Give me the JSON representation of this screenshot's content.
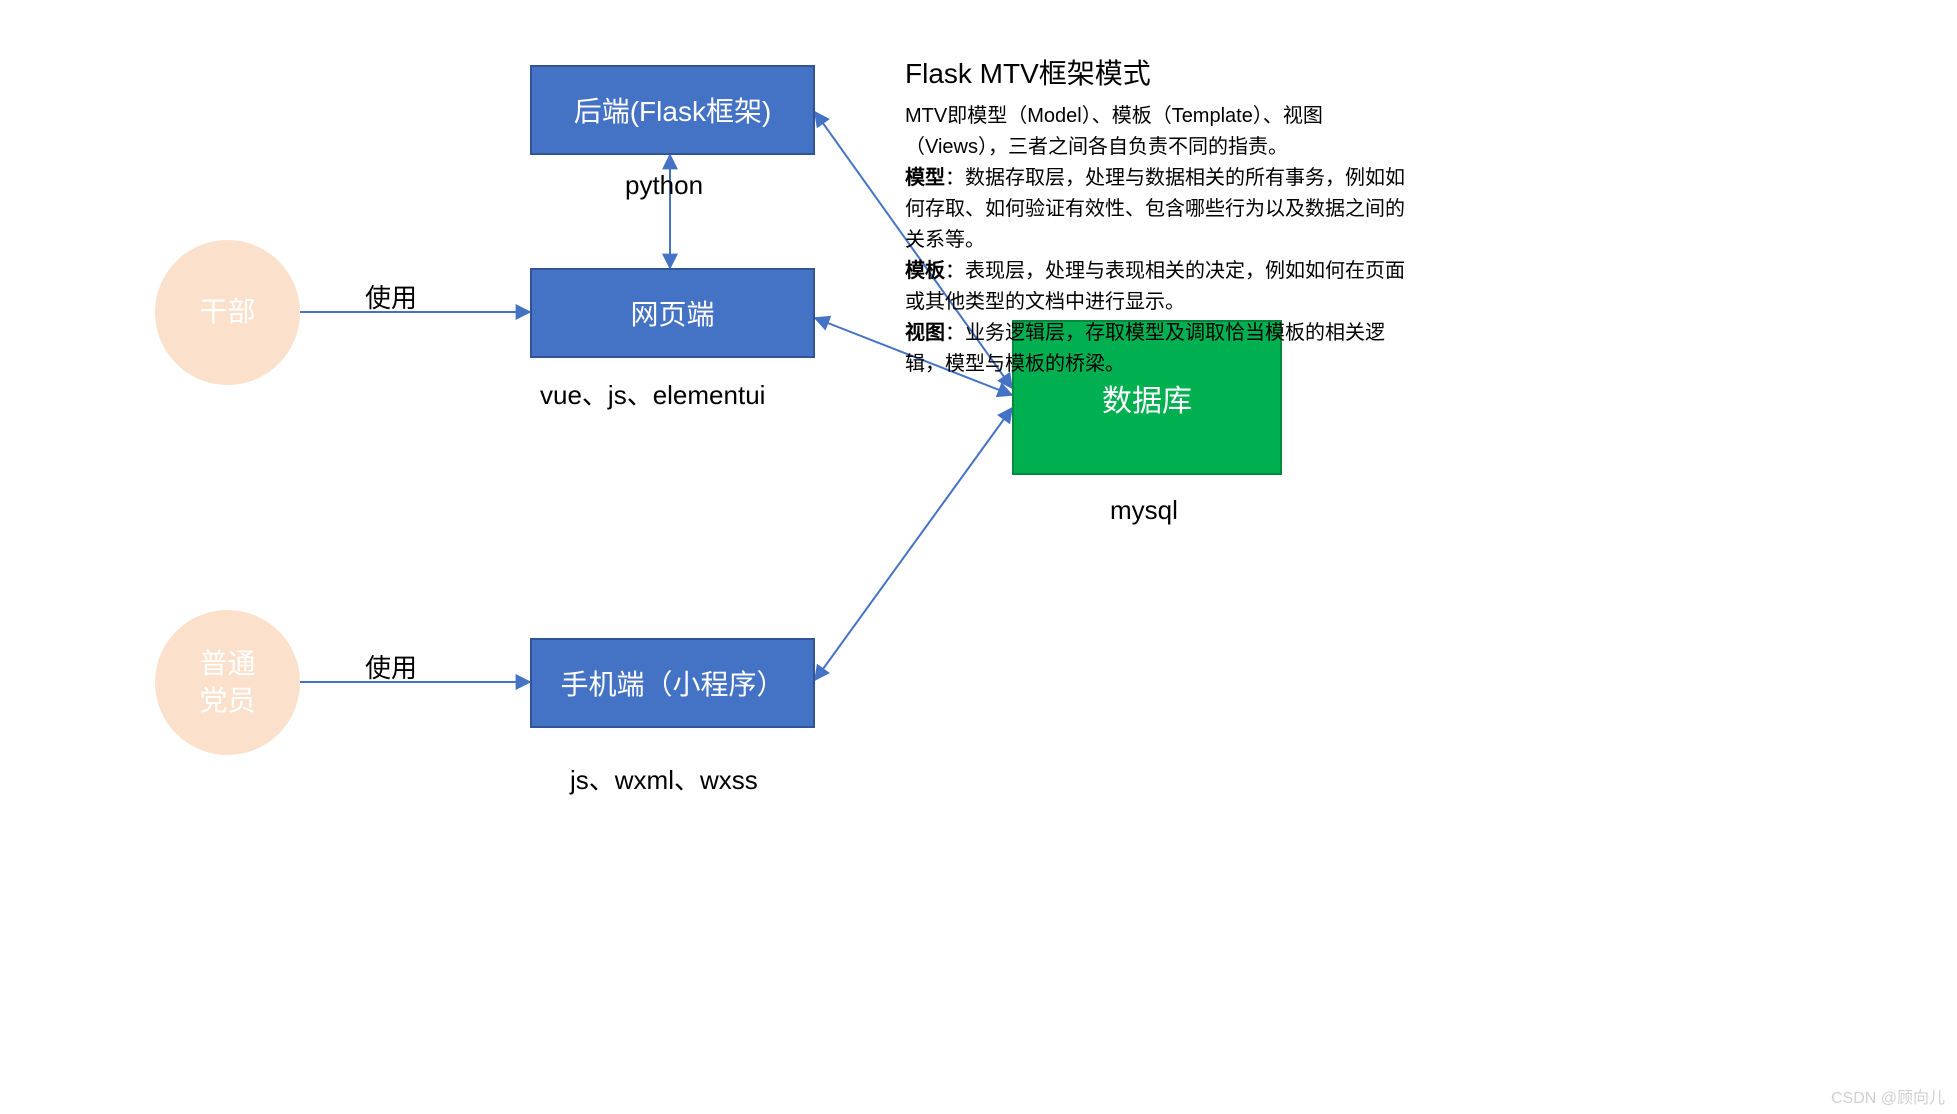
{
  "nodes": {
    "circle_cadre": "干部",
    "circle_member_line1": "普通",
    "circle_member_line2": "党员",
    "backend": "后端(Flask框架)",
    "web": "网页端",
    "mobile": "手机端（小程序）",
    "database": "数据库"
  },
  "labels": {
    "use1": "使用",
    "use2": "使用",
    "python": "python",
    "web_tech": "vue、js、elementui",
    "mobile_tech": "js、wxml、wxss",
    "mysql": "mysql"
  },
  "text": {
    "title": "Flask MTV框架模式",
    "p1": "MTV即模型（Model）、模板（Template）、视图（Views），三者之间各自负责不同的指责。",
    "p2a": "模型",
    "p2b": "：数据存取层，处理与数据相关的所有事务，例如如何存取、如何验证有效性、包含哪些行为以及数据之间的关系等。",
    "p3a": "模板",
    "p3b": "：表现层，处理与表现相关的决定，例如如何在页面或其他类型的文档中进行显示。",
    "p4a": "视图",
    "p4b": "：业务逻辑层，存取模型及调取恰当模板的相关逻辑，模型与模板的桥梁。"
  },
  "watermark": "CSDN @顾向儿"
}
